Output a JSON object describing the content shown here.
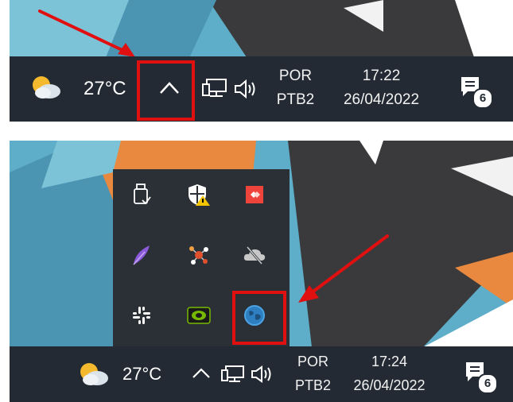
{
  "screenshot_1": {
    "taskbar": {
      "weather_temp": "27°C",
      "language": "POR",
      "keyboard_layout": "PTB2",
      "time": "17:22",
      "date": "26/04/2022",
      "notification_count": "6"
    },
    "annotation": {
      "target": "show-hidden-icons-button",
      "color": "#e01010"
    }
  },
  "screenshot_2": {
    "taskbar": {
      "weather_temp": "27°C",
      "language": "POR",
      "keyboard_layout": "PTB2",
      "time": "17:24",
      "date": "26/04/2022",
      "notification_count": "6"
    },
    "tray_icons": [
      "usb-safely-remove-icon",
      "windows-security-warning-icon",
      "anydesk-icon",
      "feather-app-icon",
      "network-app-icon",
      "onedrive-offline-icon",
      "slack-icon",
      "nvidia-icon",
      "globe-vpn-icon"
    ],
    "annotation": {
      "target": "globe-vpn-icon",
      "color": "#e01010"
    }
  }
}
